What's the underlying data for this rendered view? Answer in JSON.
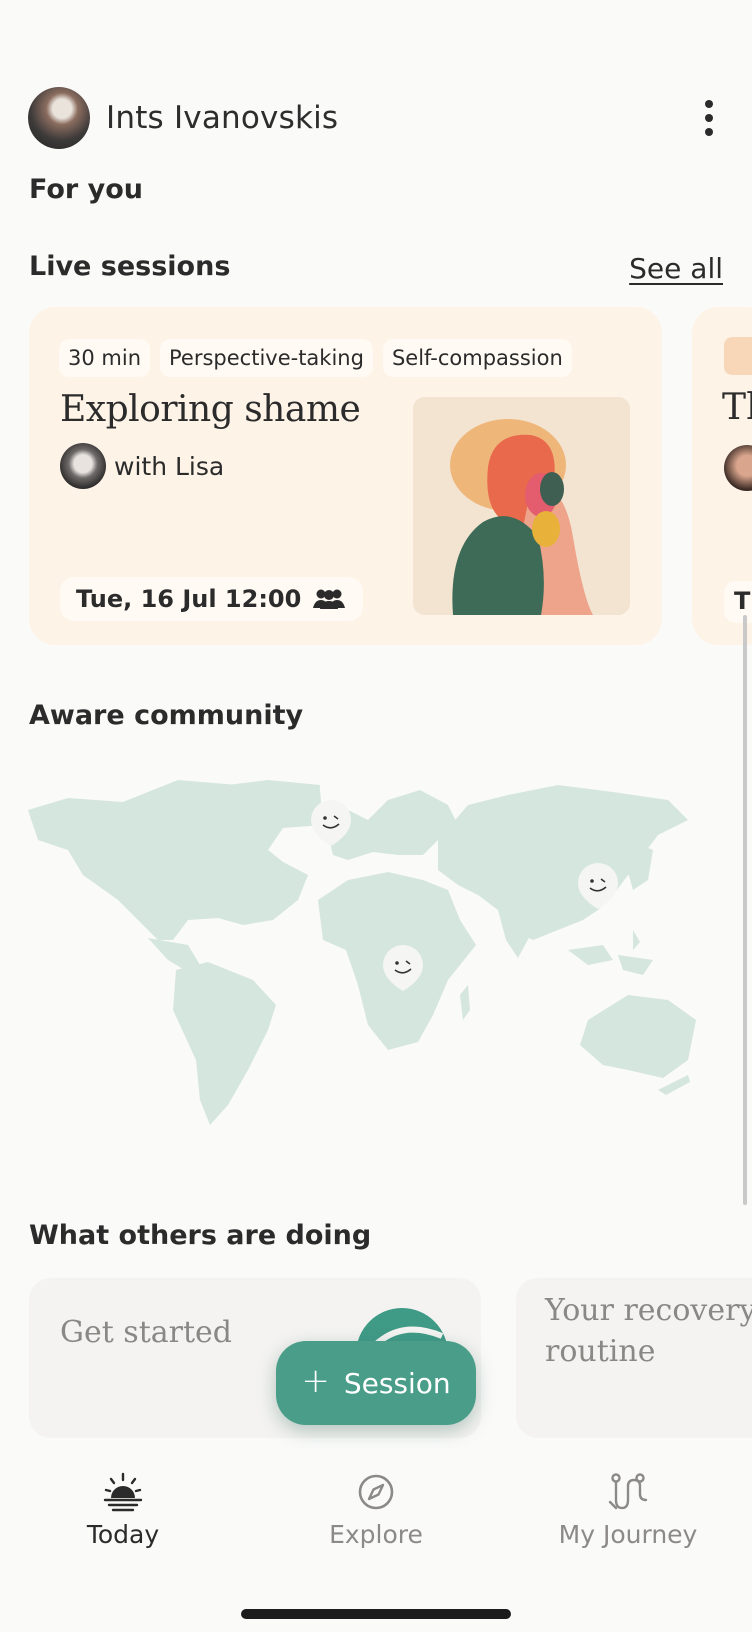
{
  "header": {
    "user_name": "Ints Ivanovskis"
  },
  "for_you": {
    "title": "For you"
  },
  "live_sessions": {
    "title": "Live sessions",
    "see_all": "See all",
    "card": {
      "tags": [
        "30 min",
        "Perspective-taking",
        "Self-compassion"
      ],
      "title": "Exploring shame",
      "host": "with Lisa",
      "datetime": "Tue, 16 Jul 12:00"
    },
    "next_card_peek": {
      "title": "Th",
      "date_initial": "T"
    }
  },
  "community": {
    "title": "Aware community"
  },
  "others": {
    "title": "What others are doing",
    "cards": [
      {
        "title": "Get started"
      },
      {
        "title_line1": "Your recovery",
        "title_line2": "routine"
      }
    ]
  },
  "fab": {
    "label": "Session"
  },
  "tabs": [
    {
      "label": "Today",
      "icon": "sunrise-icon",
      "active": true
    },
    {
      "label": "Explore",
      "icon": "compass-icon",
      "active": false
    },
    {
      "label": "My Journey",
      "icon": "journey-path-icon",
      "active": false
    }
  ],
  "colors": {
    "accent": "#4a9e89",
    "card_bg": "#fdf3e7",
    "map_land": "#d5e6df",
    "page_bg": "#fafaf9"
  }
}
